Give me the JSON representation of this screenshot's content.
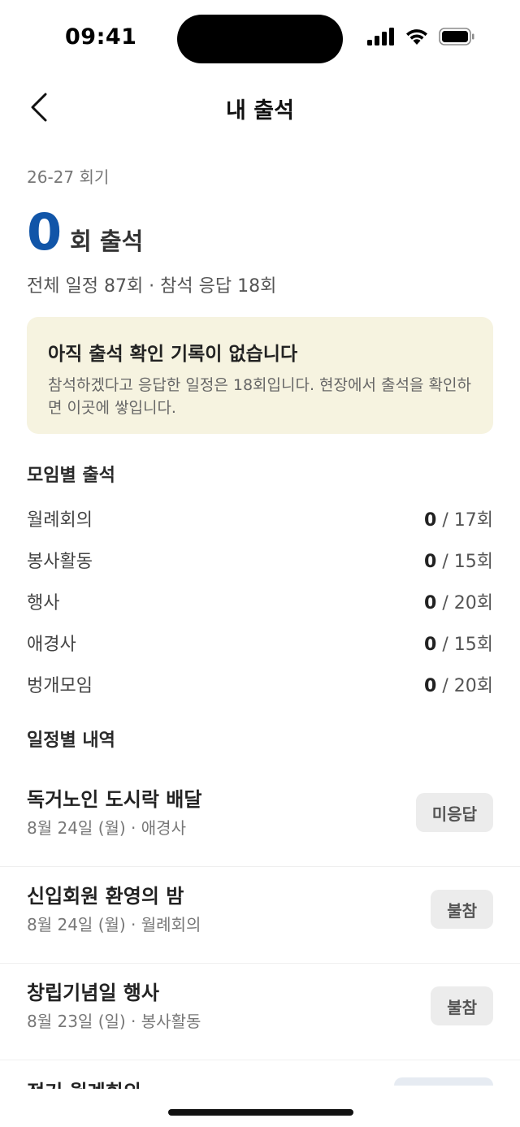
{
  "status_bar": {
    "time": "09:41"
  },
  "nav": {
    "title": "내 출석"
  },
  "summary": {
    "season": "26-27 회기",
    "count": "0",
    "count_label": "회 출석",
    "sub": "전체 일정 87회 · 참석 응답 18회"
  },
  "notice": {
    "title": "아직 출석 확인 기록이 없습니다",
    "body": "참석하겠다고 응답한 일정은 18회입니다. 현장에서 출석을 확인하면 이곳에 쌓입니다."
  },
  "groups": {
    "title": "모임별 출석",
    "items": [
      {
        "name": "월례회의",
        "attended": "0",
        "total": " / 17회"
      },
      {
        "name": "봉사활동",
        "attended": "0",
        "total": " / 15회"
      },
      {
        "name": "행사",
        "attended": "0",
        "total": " / 20회"
      },
      {
        "name": "애경사",
        "attended": "0",
        "total": " / 15회"
      },
      {
        "name": "벙개모임",
        "attended": "0",
        "total": " / 20회"
      }
    ]
  },
  "events": {
    "title": "일정별 내역",
    "items": [
      {
        "name": "독거노인 도시락 배달",
        "meta": "8월 24일 (월) · 애경사",
        "status": "미응답"
      },
      {
        "name": "신입회원 환영의 밤",
        "meta": "8월 24일 (월) · 월례회의",
        "status": "불참"
      },
      {
        "name": "창립기념일 행사",
        "meta": "8월 23일 (일) · 봉사활동",
        "status": "불참"
      },
      {
        "name": "정기 월례회의"
      }
    ]
  }
}
